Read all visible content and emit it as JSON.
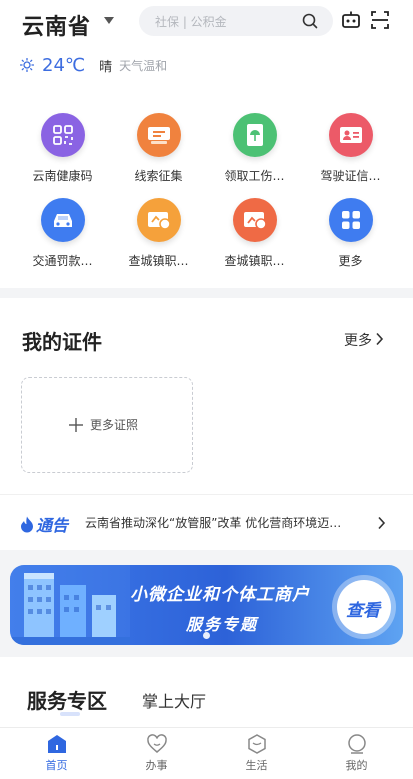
{
  "header": {
    "region": "云南省",
    "search_placeholder": "社保 | 公积金",
    "weather": {
      "temperature": "24℃",
      "condition": "晴",
      "description": "天气温和"
    }
  },
  "services": [
    {
      "label": "云南健康码",
      "icon": "qr-code-icon",
      "color": "#8a63e3"
    },
    {
      "label": "线索征集",
      "icon": "report-icon",
      "color": "#f0823e"
    },
    {
      "label": "领取工伤…",
      "icon": "umbrella-doc-icon",
      "color": "#4cc174"
    },
    {
      "label": "驾驶证信…",
      "icon": "id-card-icon",
      "color": "#ec5a68"
    },
    {
      "label": "交通罚款…",
      "icon": "car-icon",
      "color": "#3f7cf0"
    },
    {
      "label": "查城镇职…",
      "icon": "pension-card-icon",
      "color": "#f5a13b"
    },
    {
      "label": "查城镇职…",
      "icon": "pension-card-icon",
      "color": "#ef6a45"
    },
    {
      "label": "更多",
      "icon": "grid-more-icon",
      "color": "#3f7cf0"
    }
  ],
  "certificates": {
    "title": "我的证件",
    "more_label": "更多",
    "add_label": "更多证照"
  },
  "notice": {
    "logo": "通告",
    "text": "云南省推动深化“放管服”改革 优化营商环境迈…"
  },
  "banner": {
    "line1": "小微企业和个体工商户",
    "line2": "服务专题",
    "button": "查看"
  },
  "service_zone": {
    "tabs": [
      "服务专区",
      "掌上大厅"
    ]
  },
  "tabbar": [
    {
      "label": "首页",
      "active": true
    },
    {
      "label": "办事",
      "active": false
    },
    {
      "label": "生活",
      "active": false
    },
    {
      "label": "我的",
      "active": false
    }
  ]
}
